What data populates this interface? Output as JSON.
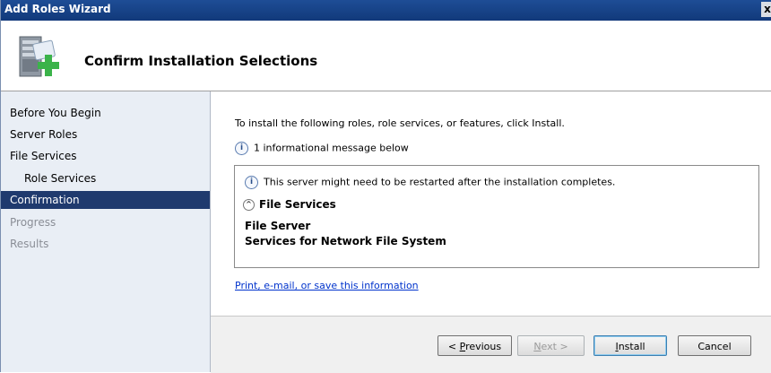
{
  "window": {
    "title": "Add Roles Wizard",
    "close_glyph": "x"
  },
  "header": {
    "heading": "Confirm Installation Selections",
    "icon": "server-add-icon"
  },
  "nav": {
    "items": [
      {
        "label": "Before You Begin",
        "state": "normal"
      },
      {
        "label": "Server Roles",
        "state": "normal"
      },
      {
        "label": "File Services",
        "state": "normal"
      },
      {
        "label": "Role Services",
        "state": "normal"
      },
      {
        "label": "Confirmation",
        "state": "selected"
      },
      {
        "label": "Progress",
        "state": "disabled"
      },
      {
        "label": "Results",
        "state": "disabled"
      }
    ]
  },
  "content": {
    "intro": "To install the following roles, role services, or features, click Install.",
    "info_count": "1 informational message below",
    "details": {
      "restart_message": "This server might need to be restarted after the installation completes.",
      "section_title": "File Services",
      "items": [
        "File Server",
        "Services for Network File System"
      ]
    },
    "link": "Print, e-mail, or save this information"
  },
  "buttons": {
    "previous": {
      "prefix": "< ",
      "underlined": "P",
      "rest": "revious"
    },
    "next": {
      "underlined": "N",
      "rest": "ext >"
    },
    "install": {
      "underlined": "I",
      "rest": "nstall"
    },
    "cancel": "Cancel"
  },
  "colors": {
    "selected_nav": "#1f3a6e",
    "link": "#0033cc",
    "titlebar": "#11397a"
  }
}
